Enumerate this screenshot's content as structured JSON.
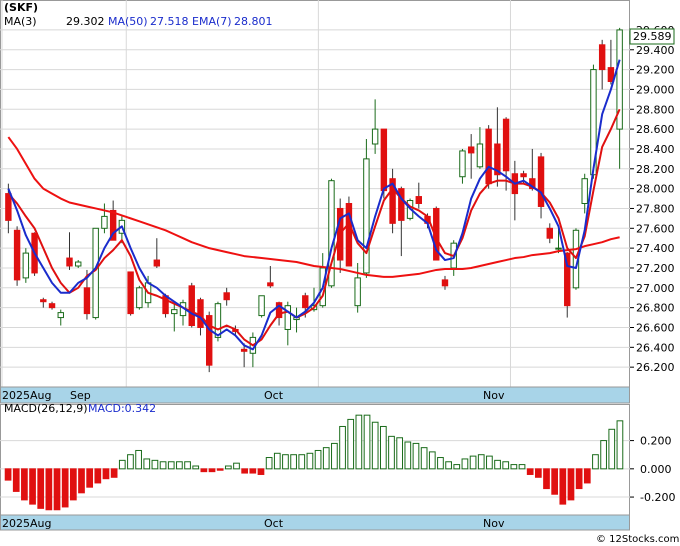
{
  "chart_data": [
    {
      "type": "candlestick",
      "title": "(SKF)",
      "legend": [
        {
          "label": "MA(3)",
          "value": "29.302",
          "color": "#000000"
        },
        {
          "label": "MA(50)",
          "value": "27.518",
          "color": "#1a2ccc"
        },
        {
          "label": "EMA(7)",
          "value": "28.801",
          "color": "#1a2ccc"
        }
      ],
      "last_price_label": "29.589",
      "ylim": [
        26.0,
        29.7
      ],
      "y_ticks": [
        "29.600",
        "29.400",
        "29.200",
        "29.000",
        "28.800",
        "28.600",
        "28.400",
        "28.200",
        "28.000",
        "27.800",
        "27.600",
        "27.400",
        "27.200",
        "27.000",
        "26.800",
        "26.600",
        "26.400",
        "26.200"
      ],
      "x_labels": [
        "2025Aug",
        "Sep",
        "Oct",
        "Nov"
      ],
      "candles": [
        [
          27.95,
          28.05,
          27.55,
          27.68
        ],
        [
          27.58,
          27.62,
          27.02,
          27.08
        ],
        [
          27.1,
          27.4,
          27.05,
          27.35
        ],
        [
          27.55,
          27.56,
          27.12,
          27.15
        ],
        [
          26.88,
          26.9,
          26.8,
          26.86
        ],
        [
          26.84,
          26.86,
          26.78,
          26.8
        ],
        [
          26.7,
          26.78,
          26.62,
          26.75
        ],
        [
          27.3,
          27.56,
          27.18,
          27.22
        ],
        [
          27.22,
          27.28,
          27.2,
          27.26
        ],
        [
          27.0,
          27.18,
          26.68,
          26.74
        ],
        [
          26.7,
          27.55,
          26.68,
          27.6
        ],
        [
          27.6,
          27.85,
          27.55,
          27.72
        ],
        [
          27.78,
          27.88,
          27.48,
          27.48
        ],
        [
          27.55,
          27.72,
          27.45,
          27.68
        ],
        [
          27.16,
          27.16,
          26.72,
          26.74
        ],
        [
          26.8,
          27.02,
          26.78,
          27.0
        ],
        [
          26.85,
          27.12,
          26.8,
          27.05
        ],
        [
          27.28,
          27.5,
          27.2,
          27.22
        ],
        [
          26.92,
          26.94,
          26.7,
          26.74
        ],
        [
          26.74,
          26.86,
          26.56,
          26.78
        ],
        [
          26.72,
          26.88,
          26.62,
          26.85
        ],
        [
          27.02,
          27.05,
          26.6,
          26.62
        ],
        [
          26.88,
          26.9,
          26.52,
          26.6
        ],
        [
          26.72,
          26.76,
          26.15,
          26.22
        ],
        [
          26.5,
          26.86,
          26.46,
          26.84
        ],
        [
          26.95,
          27.0,
          26.82,
          26.88
        ],
        [
          26.58,
          26.62,
          26.52,
          26.56
        ],
        [
          26.38,
          26.44,
          26.2,
          26.36
        ],
        [
          26.34,
          26.55,
          26.2,
          26.5
        ],
        [
          26.72,
          26.92,
          26.7,
          26.92
        ],
        [
          27.05,
          27.22,
          27.0,
          27.02
        ],
        [
          26.85,
          26.86,
          26.62,
          26.7
        ],
        [
          26.58,
          26.86,
          26.42,
          26.82
        ],
        [
          26.68,
          26.8,
          26.55,
          26.7
        ],
        [
          26.92,
          26.95,
          26.7,
          26.8
        ],
        [
          26.78,
          27.0,
          26.76,
          26.82
        ],
        [
          26.82,
          27.35,
          26.8,
          27.2
        ],
        [
          27.02,
          28.1,
          27.0,
          28.08
        ],
        [
          27.8,
          27.9,
          27.15,
          27.28
        ],
        [
          27.85,
          27.92,
          27.25,
          27.22
        ],
        [
          26.82,
          27.25,
          26.75,
          27.1
        ],
        [
          27.15,
          28.5,
          27.1,
          28.3
        ],
        [
          28.45,
          28.9,
          28.35,
          28.6
        ],
        [
          28.6,
          28.6,
          27.9,
          27.98
        ],
        [
          28.1,
          28.2,
          27.55,
          27.65
        ],
        [
          28.0,
          28.02,
          27.32,
          27.68
        ],
        [
          27.7,
          27.9,
          27.68,
          27.88
        ],
        [
          27.92,
          28.06,
          27.8,
          27.85
        ],
        [
          27.72,
          27.75,
          27.6,
          27.65
        ],
        [
          27.8,
          27.82,
          27.32,
          27.28
        ],
        [
          27.08,
          27.12,
          26.98,
          27.02
        ],
        [
          27.2,
          27.48,
          27.12,
          27.45
        ],
        [
          28.12,
          28.4,
          28.05,
          28.38
        ],
        [
          28.42,
          28.55,
          28.1,
          28.36
        ],
        [
          28.22,
          28.62,
          28.2,
          28.45
        ],
        [
          28.6,
          28.64,
          28.0,
          28.05
        ],
        [
          28.45,
          28.82,
          28.02,
          28.14
        ],
        [
          28.7,
          28.72,
          27.98,
          28.18
        ],
        [
          28.15,
          28.28,
          27.68,
          27.95
        ],
        [
          28.15,
          28.18,
          28.05,
          28.12
        ],
        [
          28.1,
          28.4,
          27.98,
          28.0
        ],
        [
          28.32,
          28.36,
          27.7,
          27.82
        ],
        [
          27.6,
          27.65,
          27.45,
          27.5
        ],
        [
          27.4,
          27.6,
          27.35,
          27.4
        ],
        [
          27.35,
          27.36,
          26.7,
          26.82
        ],
        [
          27.0,
          27.6,
          26.98,
          27.58
        ],
        [
          27.85,
          28.15,
          27.75,
          28.1
        ],
        [
          28.14,
          29.25,
          28.1,
          29.2
        ],
        [
          29.45,
          29.5,
          29.0,
          29.2
        ],
        [
          29.22,
          29.5,
          29.05,
          29.08
        ],
        [
          28.6,
          29.62,
          28.2,
          29.6
        ]
      ],
      "ma3": [
        28.52,
        28.4,
        28.25,
        28.1,
        28.0,
        27.95,
        27.9,
        27.86,
        27.84,
        27.82,
        27.8,
        27.78,
        27.76,
        27.73,
        27.7,
        27.67,
        27.64,
        27.61,
        27.58,
        27.54,
        27.5,
        27.46,
        27.43,
        27.4,
        27.38,
        27.36,
        27.34,
        27.32,
        27.31,
        27.3,
        27.29,
        27.28,
        27.27,
        27.26,
        27.24,
        27.22,
        27.21,
        27.2,
        27.19,
        27.17,
        27.15,
        27.13,
        27.12,
        27.11,
        27.11,
        27.12,
        27.13,
        27.14,
        27.16,
        27.18,
        27.19,
        27.19,
        27.19,
        27.2,
        27.22,
        27.24,
        27.26,
        27.28,
        27.3,
        27.31,
        27.33,
        27.34,
        27.35,
        27.37,
        27.38,
        27.39,
        27.42,
        27.44,
        27.46,
        27.49,
        27.51
      ],
      "ma50": [
        28.0,
        27.78,
        27.53,
        27.35,
        27.2,
        27.05,
        26.95,
        26.95,
        27.05,
        27.1,
        27.2,
        27.4,
        27.55,
        27.62,
        27.4,
        27.2,
        27.05,
        27.0,
        26.92,
        26.86,
        26.8,
        26.74,
        26.7,
        26.58,
        26.52,
        26.58,
        26.52,
        26.42,
        26.38,
        26.52,
        26.75,
        26.82,
        26.76,
        26.7,
        26.76,
        26.85,
        27.0,
        27.4,
        27.7,
        27.75,
        27.48,
        27.4,
        27.72,
        28.0,
        28.05,
        27.9,
        27.8,
        27.72,
        27.65,
        27.38,
        27.28,
        27.3,
        27.55,
        27.9,
        28.1,
        28.22,
        28.18,
        28.12,
        28.05,
        28.08,
        28.02,
        27.96,
        27.8,
        27.62,
        27.22,
        27.2,
        27.58,
        28.2,
        28.75,
        29.0,
        29.3
      ],
      "ema7": [
        27.95,
        27.85,
        27.72,
        27.6,
        27.4,
        27.2,
        27.05,
        26.95,
        27.0,
        27.12,
        27.18,
        27.3,
        27.38,
        27.48,
        27.32,
        27.08,
        26.95,
        26.92,
        26.88,
        26.84,
        26.8,
        26.76,
        26.72,
        26.62,
        26.58,
        26.62,
        26.58,
        26.48,
        26.42,
        26.48,
        26.62,
        26.74,
        26.76,
        26.7,
        26.74,
        26.8,
        26.92,
        27.25,
        27.55,
        27.65,
        27.45,
        27.35,
        27.62,
        27.88,
        28.0,
        27.9,
        27.82,
        27.78,
        27.72,
        27.5,
        27.35,
        27.32,
        27.5,
        27.78,
        27.95,
        28.05,
        28.08,
        28.08,
        28.05,
        28.05,
        28.02,
        27.96,
        27.86,
        27.7,
        27.4,
        27.3,
        27.52,
        27.98,
        28.42,
        28.6,
        28.8
      ],
      "macd": {
        "label": "MACD(26,12,9)",
        "value_label": "MACD:0.342",
        "ylim": [
          -0.32,
          0.36
        ],
        "y_ticks": [
          "0.200",
          "0.000",
          "-0.200"
        ],
        "x_labels": [
          "2025Aug",
          "Oct",
          "Nov"
        ],
        "hist": [
          -0.08,
          -0.16,
          -0.22,
          -0.25,
          -0.28,
          -0.29,
          -0.29,
          -0.27,
          -0.22,
          -0.17,
          -0.13,
          -0.1,
          -0.07,
          -0.06,
          0.06,
          0.1,
          0.13,
          0.07,
          0.06,
          0.05,
          0.05,
          0.05,
          0.05,
          0.02,
          -0.02,
          -0.02,
          -0.01,
          0.02,
          0.04,
          -0.03,
          -0.03,
          -0.04,
          0.08,
          0.11,
          0.1,
          0.1,
          0.1,
          0.11,
          0.13,
          0.15,
          0.18,
          0.3,
          0.35,
          0.38,
          0.38,
          0.33,
          0.3,
          0.23,
          0.22,
          0.19,
          0.18,
          0.15,
          0.12,
          0.08,
          0.05,
          0.03,
          0.07,
          0.09,
          0.1,
          0.09,
          0.06,
          0.05,
          0.03,
          0.03,
          -0.04,
          -0.06,
          -0.14,
          -0.18,
          -0.25,
          -0.22,
          -0.14,
          -0.1,
          0.1,
          0.2,
          0.28,
          0.34
        ]
      }
    }
  ],
  "footer": {
    "credit": "© 12Stocks.com"
  },
  "colors": {
    "up": "#1a6b1a",
    "down": "#e01010",
    "ema": "#ee1111",
    "ma": "#1a2ccc",
    "axis_band": "#a8d4e8"
  }
}
